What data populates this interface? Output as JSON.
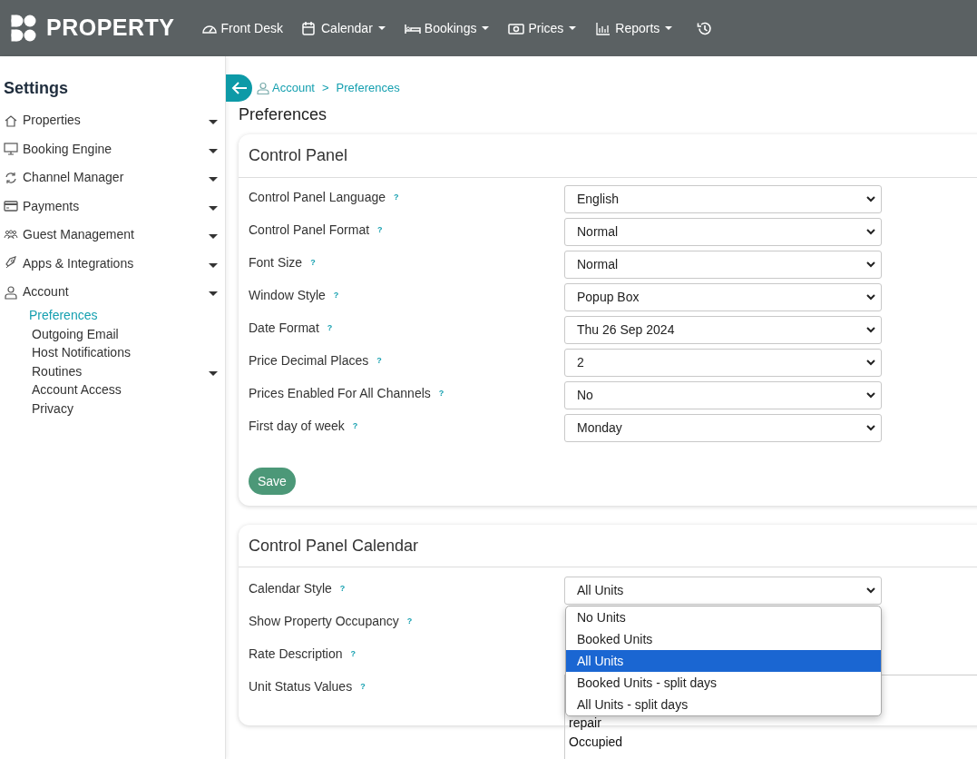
{
  "header": {
    "logo": "PROPERTY",
    "nav": [
      {
        "label": "Front Desk",
        "caret": false
      },
      {
        "label": "Calendar",
        "caret": true
      },
      {
        "label": "Bookings",
        "caret": true
      },
      {
        "label": "Prices",
        "caret": true
      },
      {
        "label": "Reports",
        "caret": true
      }
    ]
  },
  "sidebar": {
    "title": "Settings",
    "items": [
      {
        "label": "Properties",
        "caret": true
      },
      {
        "label": "Booking Engine",
        "caret": true
      },
      {
        "label": "Channel Manager",
        "caret": true
      },
      {
        "label": "Payments",
        "caret": true
      },
      {
        "label": "Guest Management",
        "caret": true
      },
      {
        "label": "Apps & Integrations",
        "caret": true
      },
      {
        "label": "Account",
        "caret": true,
        "children": [
          {
            "label": "Preferences",
            "selected": true,
            "caret": false
          },
          {
            "label": "Outgoing Email",
            "selected": false,
            "caret": false
          },
          {
            "label": "Host Notifications",
            "selected": false,
            "caret": false
          },
          {
            "label": "Routines",
            "selected": false,
            "caret": true
          },
          {
            "label": "Account Access",
            "selected": false,
            "caret": false
          },
          {
            "label": "Privacy",
            "selected": false,
            "caret": false
          }
        ]
      }
    ]
  },
  "breadcrumb": [
    "Account",
    "Preferences"
  ],
  "breadcrumb_separator": ">",
  "page_title": "Preferences",
  "cards": [
    {
      "title": "Control Panel",
      "fields": [
        {
          "kind": "select",
          "label": "Control Panel Language",
          "help": "?",
          "value": "English"
        },
        {
          "kind": "select",
          "label": "Control Panel Format",
          "help": "?",
          "value": "Normal"
        },
        {
          "kind": "select",
          "label": "Font Size",
          "help": "?",
          "value": "Normal"
        },
        {
          "kind": "select",
          "label": "Window Style",
          "help": "?",
          "value": "Popup Box"
        },
        {
          "kind": "select",
          "label": "Date Format",
          "help": "?",
          "value": "Thu 26 Sep 2024"
        },
        {
          "kind": "select",
          "label": "Price Decimal Places",
          "help": "?",
          "value": "2"
        },
        {
          "kind": "select",
          "label": "Prices Enabled For All Channels",
          "help": "?",
          "value": "No"
        },
        {
          "kind": "select",
          "label": "First day of week",
          "help": "?",
          "value": "Monday"
        }
      ],
      "save": "Save"
    },
    {
      "title": "Control Panel Calendar",
      "fields": [
        {
          "kind": "select",
          "label": "Calendar Style",
          "help": "?",
          "value": "All Units",
          "expanded": true,
          "options": [
            {
              "label": "No Units",
              "selected": false
            },
            {
              "label": "Booked Units",
              "selected": false
            },
            {
              "label": "All Units",
              "selected": true
            },
            {
              "label": "Booked Units - split days",
              "selected": false
            },
            {
              "label": "All Units - split days",
              "selected": false
            }
          ]
        },
        {
          "kind": "hidden",
          "label": "Show Property Occupancy",
          "help": "?"
        },
        {
          "kind": "hidden",
          "label": "Rate Description",
          "help": "?"
        },
        {
          "kind": "textarea",
          "label": "Unit Status Values",
          "help": "?",
          "lines": [
            "repair",
            "Occupied"
          ]
        }
      ]
    }
  ]
}
